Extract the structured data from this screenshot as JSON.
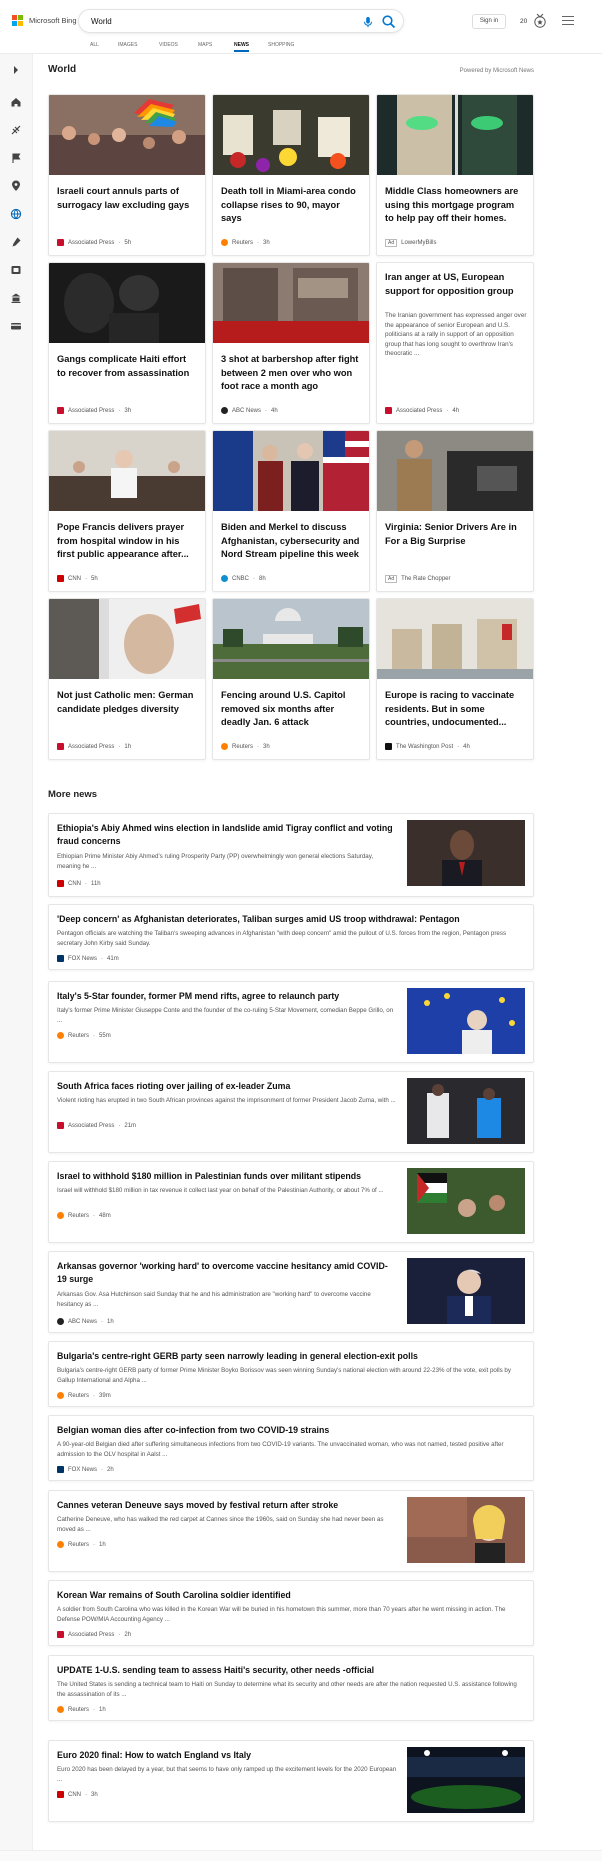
{
  "header": {
    "brand": "Microsoft Bing",
    "query": "World",
    "signin": "Sign in",
    "points": "20",
    "icons": [
      "microphone-icon",
      "search-icon",
      "rewards-medal-icon",
      "menu-icon"
    ]
  },
  "tabs": [
    {
      "label": "ALL",
      "active": false
    },
    {
      "label": "IMAGES",
      "active": false
    },
    {
      "label": "VIDEOS",
      "active": false
    },
    {
      "label": "MAPS",
      "active": false
    },
    {
      "label": "NEWS",
      "active": true
    },
    {
      "label": "SHOPPING",
      "active": false
    }
  ],
  "sidebar_icons": [
    "expand-icon",
    "home-icon",
    "sports-icon",
    "flag-icon",
    "location-icon",
    "world-icon",
    "science-icon",
    "entertainment-icon",
    "politics-icon",
    "money-icon"
  ],
  "section": {
    "title": "World",
    "powered_by": "Powered by Microsoft News"
  },
  "cards": [
    {
      "title": "Israeli court annuls parts of surrogacy law excluding gays",
      "source": "Associated Press",
      "time": "5h",
      "ad": false
    },
    {
      "title": "Death toll in Miami-area condo collapse rises to 90, mayor says",
      "source": "Reuters",
      "time": "3h",
      "ad": false
    },
    {
      "title": "Middle Class homeowners are using this mortgage program to help pay off their homes.",
      "source": "LowerMyBills",
      "time": "",
      "ad": true
    },
    {
      "title": "Gangs complicate Haiti effort to recover from assassination",
      "source": "Associated Press",
      "time": "3h",
      "ad": false
    },
    {
      "title": "3 shot at barbershop after fight between 2 men over who won foot race a month ago",
      "source": "ABC News",
      "time": "4h",
      "ad": false
    },
    {
      "title": "Iran anger at US, European support for opposition group",
      "description": "The Iranian government has expressed anger over the appearance of senior European and U.S. politicians at a rally in support of an opposition group that has long sought to overthrow Iran's theocratic ...",
      "source": "Associated Press",
      "time": "4h",
      "ad": false
    },
    {
      "title": "Pope Francis delivers prayer from hospital window in his first public appearance after...",
      "source": "CNN",
      "time": "5h",
      "ad": false
    },
    {
      "title": "Biden and Merkel to discuss Afghanistan, cybersecurity and Nord Stream pipeline this week",
      "source": "CNBC",
      "time": "8h",
      "ad": false
    },
    {
      "title": "Virginia: Senior Drivers Are in For a Big Surprise",
      "source": "The Rate Chopper",
      "time": "",
      "ad": true
    },
    {
      "title": "Not just Catholic men: German candidate pledges diversity",
      "source": "Associated Press",
      "time": "1h",
      "ad": false
    },
    {
      "title": "Fencing around U.S. Capitol removed six months after deadly Jan. 6 attack",
      "source": "Reuters",
      "time": "3h",
      "ad": false
    },
    {
      "title": "Europe is racing to vaccinate residents. But in some countries, undocumented...",
      "source": "The Washington Post",
      "time": "4h",
      "ad": false
    }
  ],
  "ad_label": "Ad",
  "more_news_title": "More news",
  "more_news": [
    {
      "title": "Ethiopia's Abiy Ahmed wins election in landslide amid Tigray conflict and voting fraud concerns",
      "description": "Ethiopian Prime Minister Abiy Ahmed's ruling Prosperity Party (PP) overwhelmingly won general elections Saturday, meaning he ...",
      "source": "CNN",
      "time": "11h"
    },
    {
      "title": "'Deep concern' as Afghanistan deteriorates, Taliban surges amid US troop withdrawal: Pentagon",
      "description": "Pentagon officials are watching the Taliban's sweeping advances in Afghanistan \"with deep concern\" amid the pullout of U.S. forces from the region, Pentagon press secretary John Kirby said Sunday.",
      "source": "FOX News",
      "time": "41m"
    },
    {
      "title": "Italy's 5-Star founder, former PM mend rifts, agree to relaunch party",
      "description": "Italy's former Prime Minister Giuseppe Conte and the founder of the co-ruling 5-Star Movement, comedian Beppe Grillo, on ...",
      "source": "Reuters",
      "time": "55m"
    },
    {
      "title": "South Africa faces rioting over jailing of ex-leader Zuma",
      "description": "Violent rioting has erupted in two South African provinces against the imprisonment of former President Jacob Zuma, with ...",
      "source": "Associated Press",
      "time": "21m"
    },
    {
      "title": "Israel to withhold $180 million in Palestinian funds over militant stipends",
      "description": "Israel will withhold $180 million in tax revenue it collect last year on behalf of the Palestinian Authority, or about 7% of ...",
      "source": "Reuters",
      "time": "48m"
    },
    {
      "title": "Arkansas governor 'working hard' to overcome vaccine hesitancy amid COVID-19 surge",
      "description": "Arkansas Gov. Asa Hutchinson said Sunday that he and his administration are \"working hard\" to overcome vaccine hesitancy as ...",
      "source": "ABC News",
      "time": "1h"
    },
    {
      "title": "Bulgaria's centre-right GERB party seen narrowly leading in general election-exit polls",
      "description": "Bulgaria's centre-right GERB party of former Prime Minister Boyko Borissov was seen winning Sunday's national election with around 22-23% of the vote, exit polls by Gallup International and Alpha ...",
      "source": "Reuters",
      "time": "39m"
    },
    {
      "title": "Belgian woman dies after co-infection from two COVID-19 strains",
      "description": "A 90-year-old Belgian died after suffering simultaneous infections from two COVID-19 variants. The unvaccinated woman, who was not named, tested positive after admission to the OLV hospital in Aalst ...",
      "source": "FOX News",
      "time": "2h"
    },
    {
      "title": "Cannes veteran Deneuve says moved by festival return after stroke",
      "description": "Catherine Deneuve, who has walked the red carpet at Cannes since the 1960s, said on Sunday she had never been as moved as ...",
      "source": "Reuters",
      "time": "1h"
    },
    {
      "title": "Korean War remains of South Carolina soldier identified",
      "description": "A soldier from South Carolina who was killed in the Korean War will be buried in his hometown this summer, more than 70 years after he went missing in action. The Defense POW/MIA Accounting Agency ...",
      "source": "Associated Press",
      "time": "2h"
    },
    {
      "title": "UPDATE 1-U.S. sending team to assess Haiti's security, other needs -official",
      "description": "The United States is sending a technical team to Haiti on Sunday to determine what its security and other needs are after the nation requested U.S. assistance following the assassination of its ...",
      "source": "Reuters",
      "time": "1h"
    },
    {
      "title": "Euro 2020 final: How to watch England vs Italy",
      "description": "Euro 2020 has been delayed by a year, but that seems to have only ramped up the excitement levels for the 2020 European ...",
      "source": "CNN",
      "time": "3h"
    }
  ],
  "source_colors": {
    "Associated Press": "#c8102e",
    "Reuters": "#ff8000",
    "CNN": "#cc0000",
    "ABC News": "#222222",
    "CNBC": "#0f8fcd",
    "FOX News": "#003366",
    "The Washington Post": "#111111",
    "LowerMyBills": "#888888",
    "The Rate Chopper": "#888888"
  }
}
